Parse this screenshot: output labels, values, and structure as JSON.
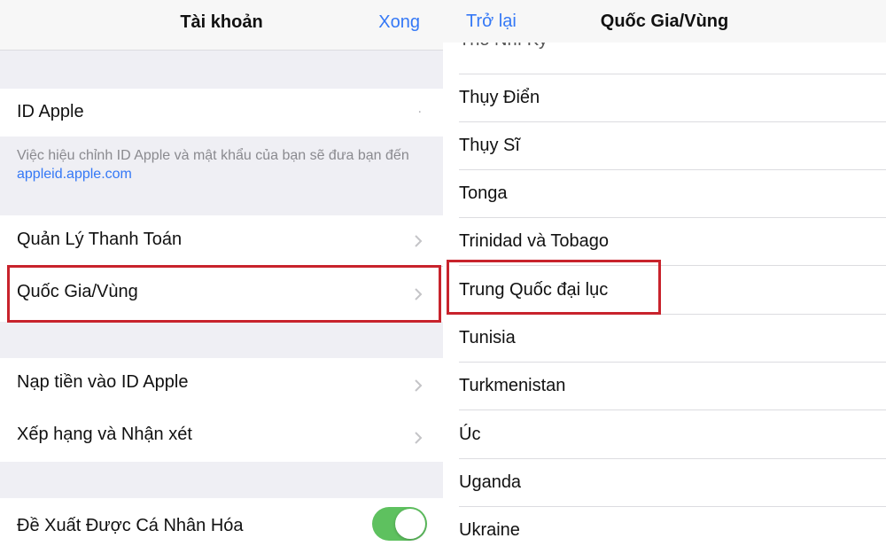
{
  "left": {
    "nav": {
      "title": "Tài khoản",
      "done": "Xong"
    },
    "apple_id": {
      "label": "ID Apple",
      "value": "."
    },
    "footer": {
      "text": "Việc hiệu chỉnh ID Apple và mật khẩu của bạn sẽ đưa bạn đến",
      "link": "appleid.apple.com"
    },
    "rows": [
      {
        "label": "Quản Lý Thanh Toán"
      },
      {
        "label": "Quốc Gia/Vùng"
      },
      {
        "label": "Nạp tiền vào ID Apple"
      },
      {
        "label": "Xếp hạng và Nhận xét"
      }
    ],
    "personalized": {
      "label": "Đề Xuất Được Cá Nhân Hóa",
      "on": true
    }
  },
  "right": {
    "nav": {
      "back": "Trở lại",
      "title": "Quốc Gia/Vùng"
    },
    "partial_item": "Thổ Nhĩ Kỳ",
    "countries": [
      "Thụy Điển",
      "Thụy Sĩ",
      "Tonga",
      "Trinidad và Tobago",
      "Trung Quốc đại lục",
      "Tunisia",
      "Turkmenistan",
      "Úc",
      "Uganda",
      "Ukraine"
    ],
    "highlighted": "Trung Quốc đại lục"
  },
  "colors": {
    "accent": "#3478f6",
    "highlight": "#c8232c",
    "toggle_on": "#5ec15f"
  }
}
